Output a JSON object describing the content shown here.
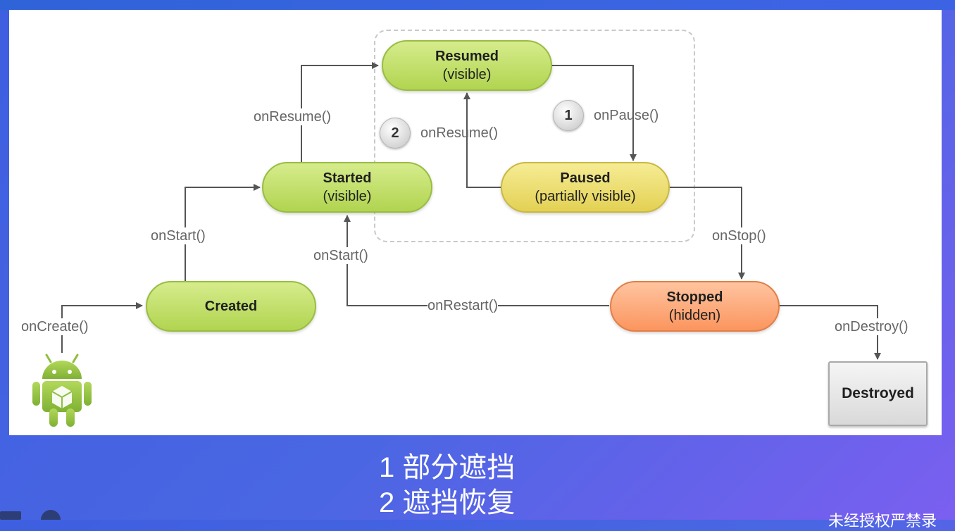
{
  "diagram": {
    "states": {
      "resumed": {
        "name": "Resumed",
        "sub": "(visible)"
      },
      "started": {
        "name": "Started",
        "sub": "(visible)"
      },
      "paused": {
        "name": "Paused",
        "sub": "(partially visible)"
      },
      "created": {
        "name": "Created"
      },
      "stopped": {
        "name": "Stopped",
        "sub": "(hidden)"
      },
      "destroyed": {
        "name": "Destroyed"
      }
    },
    "transitions": {
      "on_create": "onCreate()",
      "on_start_left": "onStart()",
      "on_resume_left": "onResume()",
      "on_resume_inner": "onResume()",
      "on_pause": "onPause()",
      "on_stop": "onStop()",
      "on_start_mid": "onStart()",
      "on_restart": "onRestart()",
      "on_destroy": "onDestroy()"
    },
    "badges": {
      "one": "1",
      "two": "2"
    },
    "colors": {
      "active_state": "#b1d450",
      "paused_state": "#e3d154",
      "stopped_state": "#fb955e",
      "destroyed_state": "#d9d9d9",
      "arrow": "#555555"
    },
    "icons": {
      "start": "android-robot-icon"
    }
  },
  "captions": {
    "line1": "1 部分遮挡",
    "line2": "2 遮挡恢复"
  },
  "watermark": "未经授权严禁录"
}
